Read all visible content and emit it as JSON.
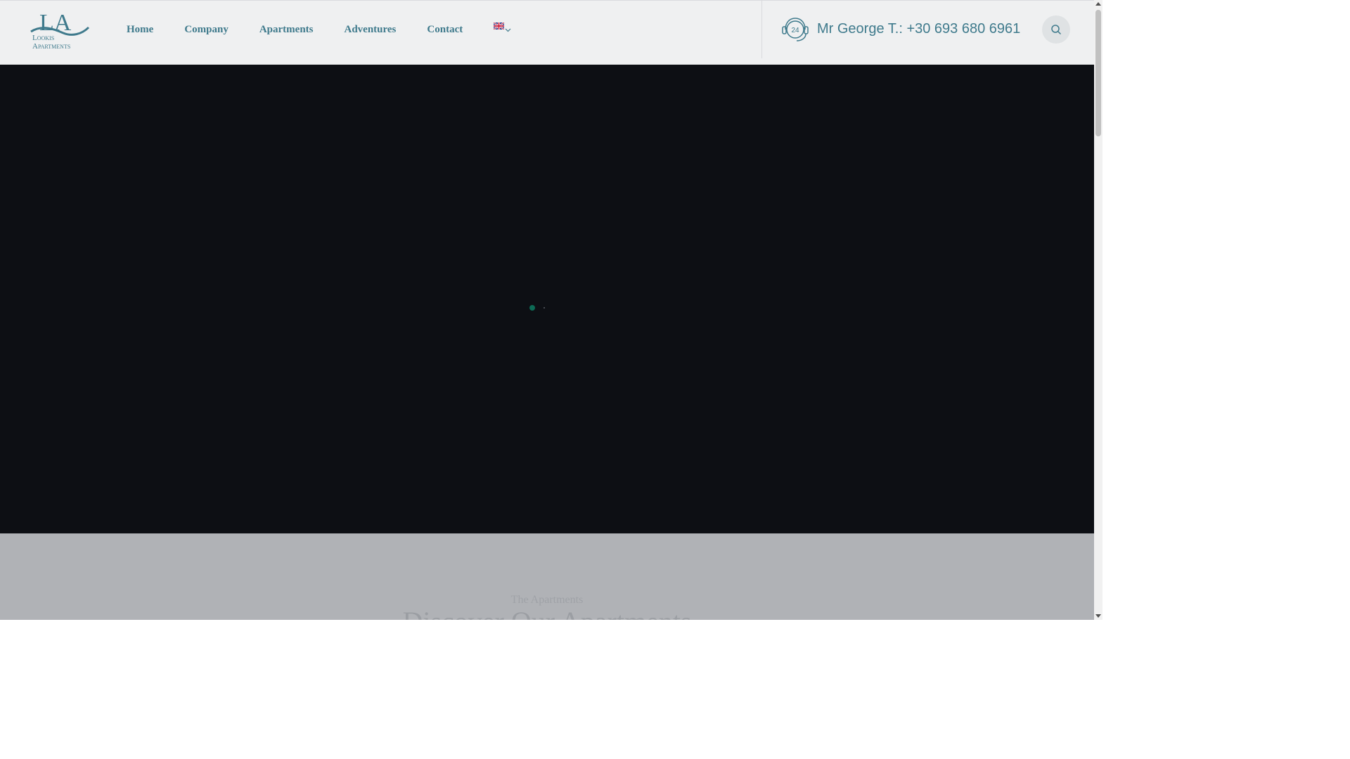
{
  "header": {
    "logo": {
      "monogram": "LA",
      "line1": "Lookis",
      "line2": "Apartments"
    },
    "nav": [
      {
        "label": "Home"
      },
      {
        "label": "Company"
      },
      {
        "label": "Apartments"
      },
      {
        "label": "Adventures"
      },
      {
        "label": "Contact"
      }
    ],
    "language": {
      "icon": "uk-flag-icon",
      "dropdown_icon": "chevron-down-icon"
    },
    "phone": {
      "icon": "support-24h-icon",
      "text": "Mr George T.: +30 693 680 6961"
    },
    "search": {
      "icon": "search-icon"
    }
  },
  "hero": {
    "slides_total": 2,
    "active_slide": 1
  },
  "section": {
    "subtitle": "The Apartments",
    "title": "Discover Our Apartments"
  },
  "colors": {
    "accent": "#3f7a8c",
    "hero_bg": "#0d0f14",
    "header_bg": "#eff0f1",
    "active_dot": "#0d6a55"
  }
}
